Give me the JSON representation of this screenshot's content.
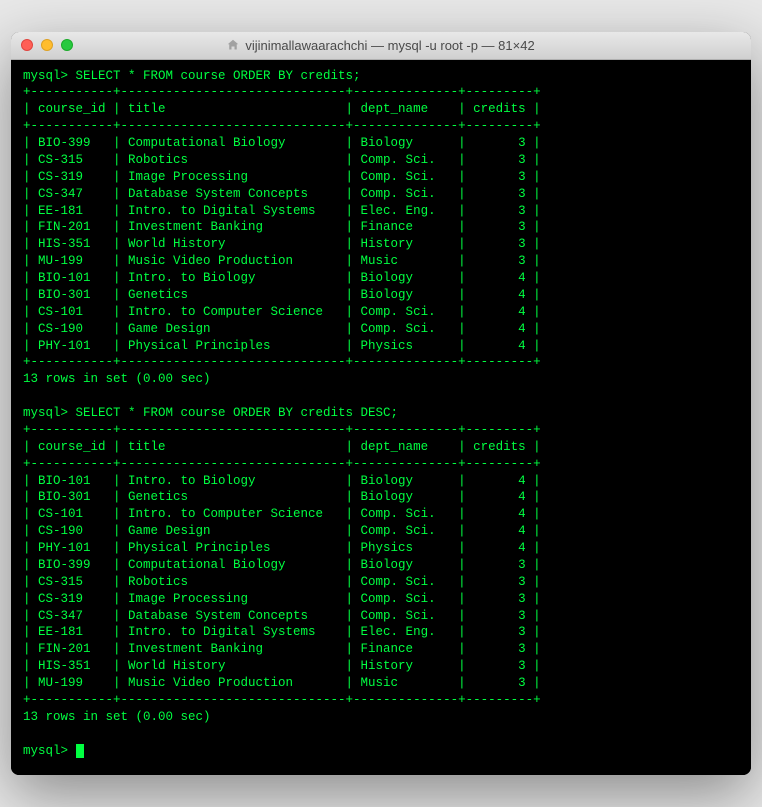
{
  "window": {
    "title": "vijinimallawaarachchi — mysql -u root -p — 81×42"
  },
  "prompt": "mysql> ",
  "queries": [
    {
      "sql": "SELECT * FROM course ORDER BY credits;",
      "result_summary": "13 rows in set (0.00 sec)",
      "columns": [
        "course_id",
        "title",
        "dept_name",
        "credits"
      ],
      "rows": [
        [
          "BIO-399",
          "Computational Biology",
          "Biology",
          "3"
        ],
        [
          "CS-315",
          "Robotics",
          "Comp. Sci.",
          "3"
        ],
        [
          "CS-319",
          "Image Processing",
          "Comp. Sci.",
          "3"
        ],
        [
          "CS-347",
          "Database System Concepts",
          "Comp. Sci.",
          "3"
        ],
        [
          "EE-181",
          "Intro. to Digital Systems",
          "Elec. Eng.",
          "3"
        ],
        [
          "FIN-201",
          "Investment Banking",
          "Finance",
          "3"
        ],
        [
          "HIS-351",
          "World History",
          "History",
          "3"
        ],
        [
          "MU-199",
          "Music Video Production",
          "Music",
          "3"
        ],
        [
          "BIO-101",
          "Intro. to Biology",
          "Biology",
          "4"
        ],
        [
          "BIO-301",
          "Genetics",
          "Biology",
          "4"
        ],
        [
          "CS-101",
          "Intro. to Computer Science",
          "Comp. Sci.",
          "4"
        ],
        [
          "CS-190",
          "Game Design",
          "Comp. Sci.",
          "4"
        ],
        [
          "PHY-101",
          "Physical Principles",
          "Physics",
          "4"
        ]
      ]
    },
    {
      "sql": "SELECT * FROM course ORDER BY credits DESC;",
      "result_summary": "13 rows in set (0.00 sec)",
      "columns": [
        "course_id",
        "title",
        "dept_name",
        "credits"
      ],
      "rows": [
        [
          "BIO-101",
          "Intro. to Biology",
          "Biology",
          "4"
        ],
        [
          "BIO-301",
          "Genetics",
          "Biology",
          "4"
        ],
        [
          "CS-101",
          "Intro. to Computer Science",
          "Comp. Sci.",
          "4"
        ],
        [
          "CS-190",
          "Game Design",
          "Comp. Sci.",
          "4"
        ],
        [
          "PHY-101",
          "Physical Principles",
          "Physics",
          "4"
        ],
        [
          "BIO-399",
          "Computational Biology",
          "Biology",
          "3"
        ],
        [
          "CS-315",
          "Robotics",
          "Comp. Sci.",
          "3"
        ],
        [
          "CS-319",
          "Image Processing",
          "Comp. Sci.",
          "3"
        ],
        [
          "CS-347",
          "Database System Concepts",
          "Comp. Sci.",
          "3"
        ],
        [
          "EE-181",
          "Intro. to Digital Systems",
          "Elec. Eng.",
          "3"
        ],
        [
          "FIN-201",
          "Investment Banking",
          "Finance",
          "3"
        ],
        [
          "HIS-351",
          "World History",
          "History",
          "3"
        ],
        [
          "MU-199",
          "Music Video Production",
          "Music",
          "3"
        ]
      ]
    }
  ],
  "widths": [
    9,
    28,
    12,
    7
  ]
}
